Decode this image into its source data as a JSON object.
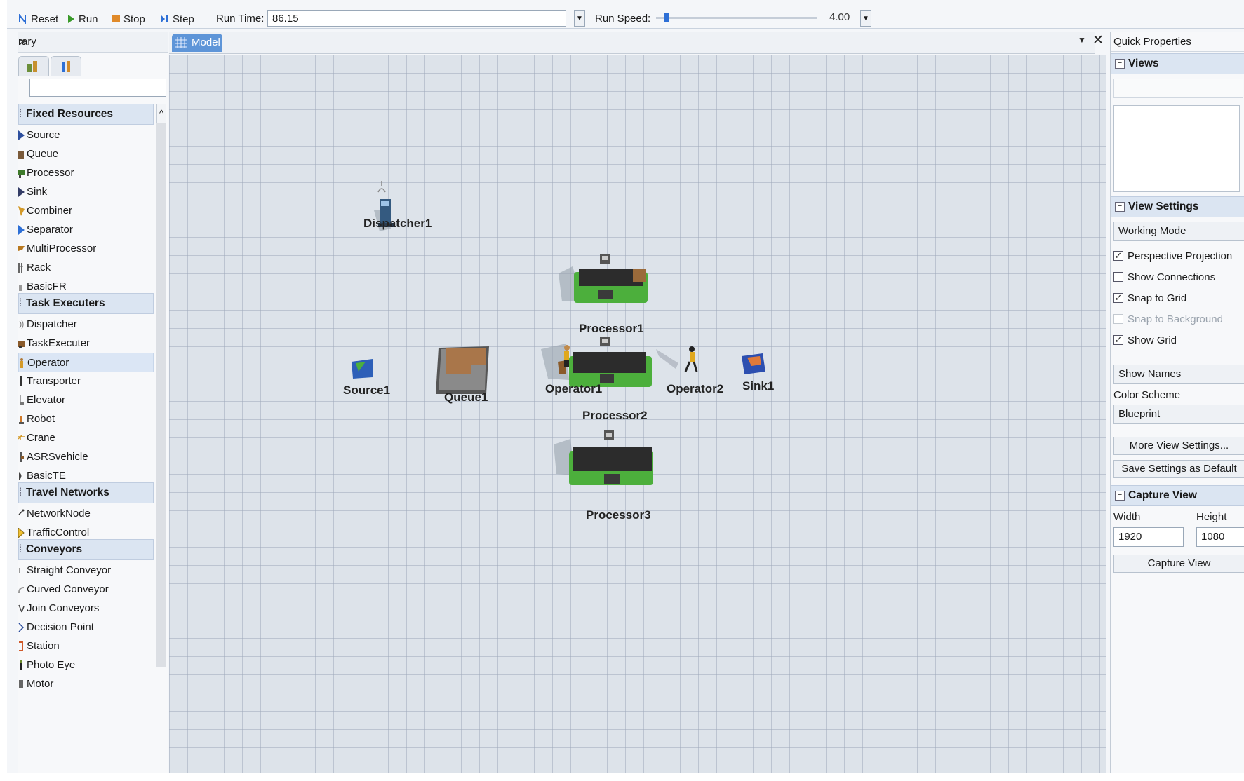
{
  "toolbar": {
    "reset_label": "Reset",
    "run_label": "Run",
    "stop_label": "Stop",
    "step_label": "Step",
    "runtime_label": "Run Time:",
    "runtime_value": "86.15",
    "speed_label": "Run Speed:",
    "speed_value": "4.00",
    "speed_fraction": 0.05
  },
  "library": {
    "title": "rary",
    "categories": [
      {
        "label": "Fixed Resources",
        "items": [
          "Source",
          "Queue",
          "Processor",
          "Sink",
          "Combiner",
          "Separator",
          "MultiProcessor",
          "Rack",
          "BasicFR"
        ]
      },
      {
        "label": "Task Executers",
        "items": [
          "Dispatcher",
          "TaskExecuter",
          "Operator",
          "Transporter",
          "Elevator",
          "Robot",
          "Crane",
          "ASRSvehicle",
          "BasicTE"
        ],
        "selected": "Operator"
      },
      {
        "label": "Travel Networks",
        "items": [
          "NetworkNode",
          "TrafficControl"
        ]
      },
      {
        "label": "Conveyors",
        "items": [
          "Straight Conveyor",
          "Curved Conveyor",
          "Join Conveyors",
          "Decision Point",
          "Station",
          "Photo Eye",
          "Motor"
        ]
      }
    ]
  },
  "model": {
    "tab_label": "Model",
    "objects": {
      "dispatcher1": "Dispatcher1",
      "processor1": "Processor1",
      "source1": "Source1",
      "queue1": "Queue1",
      "operator1": "Operator1",
      "operator2": "Operator2",
      "sink1": "Sink1",
      "processor2": "Processor2",
      "processor3": "Processor3"
    }
  },
  "quick_properties": {
    "title": "Quick Properties",
    "views_label": "Views",
    "view_settings_label": "View Settings",
    "working_mode": "Working Mode",
    "checks": {
      "perspective": {
        "label": "Perspective Projection",
        "checked": true
      },
      "connections": {
        "label": "Show Connections",
        "checked": false
      },
      "snap_grid": {
        "label": "Snap to Grid",
        "checked": true
      },
      "snap_background": {
        "label": "Snap to Background",
        "checked": false
      },
      "show_grid": {
        "label": "Show Grid",
        "checked": true
      }
    },
    "show_names": "Show Names",
    "color_scheme_label": "Color Scheme",
    "color_scheme_value": "Blueprint",
    "more_settings_label": "More View Settings...",
    "save_default_label": "Save Settings as Default",
    "capture_view_label": "Capture View",
    "width_label": "Width",
    "width_value": "1920",
    "height_label": "Height",
    "height_value": "1080",
    "capture_button_label": "Capture View"
  },
  "colors": {
    "accent": "#5e95d8",
    "category_bg": "#dbe5f2",
    "grid_bg": "#dde3ea",
    "processor_green": "#4caf3c"
  }
}
